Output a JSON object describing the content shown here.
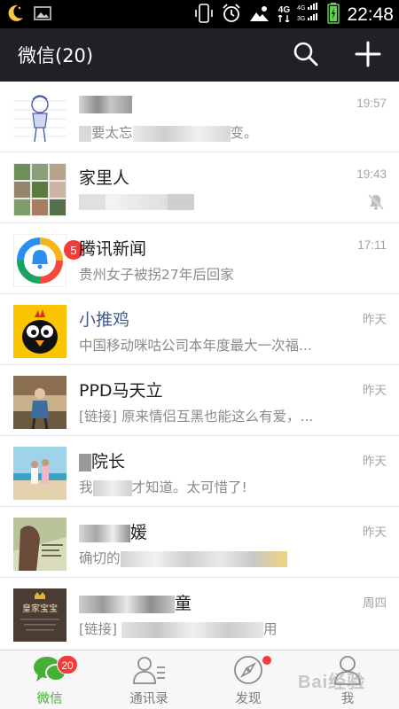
{
  "status_bar": {
    "time": "22:48",
    "network_type": "4G",
    "network_sub": "4G",
    "icons": [
      "moon-icon",
      "image-icon",
      "vibrate-icon",
      "alarm-icon",
      "weather-icon",
      "signal-icon",
      "battery-icon"
    ],
    "battery_color": "#5fd14b"
  },
  "header": {
    "title": "微信(20)",
    "search_icon": "search-icon",
    "add_icon": "plus-icon"
  },
  "chats": [
    {
      "name": "",
      "preview_parts": [
        "",
        "要太忘",
        "",
        "变。"
      ],
      "time": "19:57",
      "muted": false,
      "unread": null,
      "name_style": "normal"
    },
    {
      "name": "家里人",
      "preview_parts": [
        "",
        ""
      ],
      "time": "19:43",
      "muted": true,
      "unread": null,
      "name_style": "normal"
    },
    {
      "name": "腾讯新闻",
      "preview_parts": [
        "贵州女子被拐27年后回家"
      ],
      "time": "17:11",
      "muted": false,
      "unread": "5",
      "name_style": "normal"
    },
    {
      "name": "小推鸡",
      "preview_parts": [
        "中国移动咪咕公司本年度最大一次福..."
      ],
      "time": "昨天",
      "muted": false,
      "unread": null,
      "name_style": "link"
    },
    {
      "name": "PPD马天立",
      "preview_parts": [
        "[链接] 原来情侣互黑也能这么有爱，..."
      ],
      "time": "昨天",
      "muted": false,
      "unread": null,
      "name_style": "normal"
    },
    {
      "name": "院长",
      "preview_parts": [
        "我",
        "才知道。太可惜了!"
      ],
      "time": "昨天",
      "muted": false,
      "unread": null,
      "name_style": "normal"
    },
    {
      "name": "媛",
      "preview_parts": [
        "确切的",
        ""
      ],
      "time": "昨天",
      "muted": false,
      "unread": null,
      "name_style": "normal"
    },
    {
      "name": "童",
      "preview_parts": [
        "[链接]",
        "用"
      ],
      "time": "周四",
      "muted": false,
      "unread": null,
      "name_style": "normal"
    }
  ],
  "avatar_text": {
    "row8": "皇家宝宝"
  },
  "bottom_nav": [
    {
      "label": "微信",
      "icon": "chat-bubbles-icon",
      "active": true,
      "badge": "20",
      "dot": false
    },
    {
      "label": "通讯录",
      "icon": "contacts-icon",
      "active": false,
      "badge": null,
      "dot": false
    },
    {
      "label": "发现",
      "icon": "compass-icon",
      "active": false,
      "badge": null,
      "dot": true
    },
    {
      "label": "我",
      "icon": "person-icon",
      "active": false,
      "badge": null,
      "dot": false
    }
  ],
  "watermark": "Bai经验",
  "colors": {
    "header_bg": "#1f2124",
    "accent_green": "#45b035",
    "badge_red": "#f23b3b",
    "link_name": "#3f5b8f"
  }
}
